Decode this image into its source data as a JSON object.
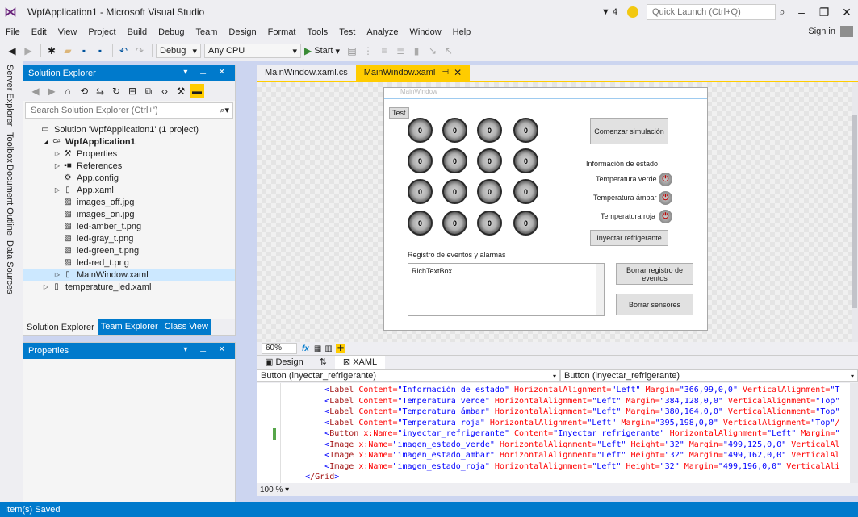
{
  "window": {
    "title": "WpfApplication1 - Microsoft Visual Studio",
    "notification_count": "4",
    "quick_launch_placeholder": "Quick Launch (Ctrl+Q)"
  },
  "menu": {
    "items": [
      "File",
      "Edit",
      "View",
      "Project",
      "Build",
      "Debug",
      "Team",
      "Design",
      "Format",
      "Tools",
      "Test",
      "Analyze",
      "Window",
      "Help"
    ],
    "sign_in": "Sign in"
  },
  "toolbar": {
    "configuration": "Debug",
    "platform": "Any CPU",
    "start_label": "Start"
  },
  "side_tabs": [
    "Server Explorer",
    "Toolbox",
    "Document Outline",
    "Data Sources"
  ],
  "solution_explorer": {
    "title": "Solution Explorer",
    "search_placeholder": "Search Solution Explorer (Ctrl+')",
    "tree": [
      {
        "label": "Solution 'WpfApplication1' (1 project)",
        "indent": 0,
        "arrow": "",
        "icon": "solution-icon"
      },
      {
        "label": "WpfApplication1",
        "indent": 1,
        "arrow": "◢",
        "icon": "csharp-project-icon",
        "bold": true
      },
      {
        "label": "Properties",
        "indent": 2,
        "arrow": "▷",
        "icon": "wrench-icon"
      },
      {
        "label": "References",
        "indent": 2,
        "arrow": "▷",
        "icon": "references-icon"
      },
      {
        "label": "App.config",
        "indent": 2,
        "arrow": "",
        "icon": "config-file-icon"
      },
      {
        "label": "App.xaml",
        "indent": 2,
        "arrow": "▷",
        "icon": "xaml-file-icon"
      },
      {
        "label": "images_off.jpg",
        "indent": 2,
        "arrow": "",
        "icon": "image-file-icon"
      },
      {
        "label": "images_on.jpg",
        "indent": 2,
        "arrow": "",
        "icon": "image-file-icon"
      },
      {
        "label": "led-amber_t.png",
        "indent": 2,
        "arrow": "",
        "icon": "image-file-icon"
      },
      {
        "label": "led-gray_t.png",
        "indent": 2,
        "arrow": "",
        "icon": "image-file-icon"
      },
      {
        "label": "led-green_t.png",
        "indent": 2,
        "arrow": "",
        "icon": "image-file-icon"
      },
      {
        "label": "led-red_t.png",
        "indent": 2,
        "arrow": "",
        "icon": "image-file-icon"
      },
      {
        "label": "MainWindow.xaml",
        "indent": 2,
        "arrow": "▷",
        "icon": "xaml-file-icon",
        "selected": true
      },
      {
        "label": "temperature_led.xaml",
        "indent": 1,
        "arrow": "▷",
        "icon": "xaml-file-icon"
      }
    ],
    "tabs": [
      "Solution Explorer",
      "Team Explorer",
      "Class View"
    ]
  },
  "properties": {
    "title": "Properties"
  },
  "document_tabs": [
    "MainWindow.xaml.cs",
    "MainWindow.xaml"
  ],
  "designer": {
    "window_title": "MainWindow",
    "test_button": "Test",
    "led_value": "0",
    "led_count": 16,
    "start_button": "Comenzar simulación",
    "status_label": "Información de estado",
    "temp_green": "Temperatura verde",
    "temp_amber": "Temperatura ámbar",
    "temp_red": "Temperatura roja",
    "inject_button": "Inyectar refrigerante",
    "events_label": "Registro de eventos y alarmas",
    "richtextbox": "RichTextBox",
    "clear_log_button": "Borrar registro de eventos",
    "clear_sensors_button": "Borrar sensores"
  },
  "zoom": {
    "designer_zoom": "60%",
    "editor_zoom": "100 %"
  },
  "view_tabs": {
    "design": "Design",
    "swap": "⇅",
    "xaml": "XAML"
  },
  "nav": {
    "left": "Button (inyectar_refrigerante)",
    "right": "Button (inyectar_refrigerante)"
  },
  "code_lines": [
    {
      "tag": "Label",
      "attrs": "Content=\"Información de estado\" HorizontalAlignment=\"Left\" Margin=\"366,99,0,0\" VerticalAlignment=\"T"
    },
    {
      "tag": "Label",
      "attrs": "Content=\"Temperatura verde\" HorizontalAlignment=\"Left\" Margin=\"384,128,0,0\" VerticalAlignment=\"Top\""
    },
    {
      "tag": "Label",
      "attrs": "Content=\"Temperatura ámbar\" HorizontalAlignment=\"Left\" Margin=\"380,164,0,0\" VerticalAlignment=\"Top\""
    },
    {
      "tag": "Label",
      "attrs": "Content=\"Temperatura roja\" HorizontalAlignment=\"Left\" Margin=\"395,198,0,0\" VerticalAlignment=\"Top\"/"
    },
    {
      "tag": "Button",
      "attrs": "x:Name=\"inyectar_refrigerante\" Content=\"Inyectar refrigerante\" HorizontalAlignment=\"Left\" Margin=\""
    },
    {
      "tag": "Image",
      "attrs": "x:Name=\"imagen_estado_verde\" HorizontalAlignment=\"Left\" Height=\"32\" Margin=\"499,125,0,0\" VerticalAl"
    },
    {
      "tag": "Image",
      "attrs": "x:Name=\"imagen_estado_ambar\" HorizontalAlignment=\"Left\" Height=\"32\" Margin=\"499,162,0,0\" VerticalAl"
    },
    {
      "tag": "Image",
      "attrs": "x:Name=\"imagen_estado_roja\" HorizontalAlignment=\"Left\" Height=\"32\" Margin=\"499,196,0,0\" VerticalAli"
    },
    {
      "tag": "/Grid",
      "attrs": ""
    }
  ],
  "status": {
    "text": "Item(s) Saved"
  },
  "colors": {
    "accent": "#007acc",
    "active_tab": "#ffcc00",
    "chrome": "#eeeef2"
  }
}
